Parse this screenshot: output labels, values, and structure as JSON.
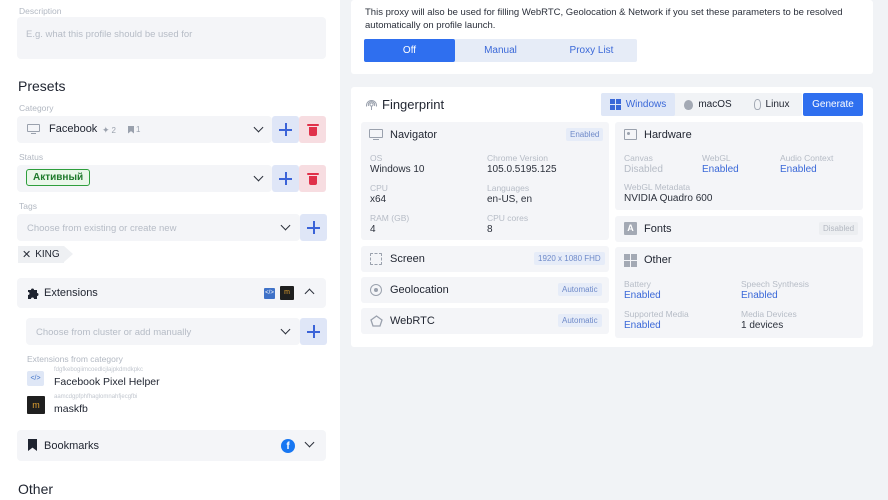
{
  "left": {
    "description": {
      "label": "Description",
      "placeholder": "E.g. what this profile should be used for"
    },
    "presets_title": "Presets",
    "category": {
      "label": "Category",
      "value": "Facebook",
      "pin_count": "2",
      "bookmark_count": "1"
    },
    "status": {
      "label": "Status",
      "value": "Активный",
      "color": "#2e9e3c"
    },
    "tags": {
      "label": "Tags",
      "placeholder": "Choose from existing or create new",
      "items": [
        "KING"
      ]
    },
    "extensions": {
      "title": "Extensions",
      "placeholder": "Choose from cluster or add manually",
      "from_category_label": "Extensions from category",
      "items": [
        {
          "id": "fdgfkebogiimcoedlcjlajpkdmdkpkc",
          "name": "Facebook Pixel Helper",
          "icon": "code-icon"
        },
        {
          "id": "aamcdgpfphfhaglomnahfjecgfbi",
          "name": "maskfb",
          "icon": "maskfb-icon"
        }
      ]
    },
    "bookmarks": {
      "title": "Bookmarks"
    },
    "other_title": "Other"
  },
  "proxy": {
    "note": "This proxy will also be used for filling WebRTC, Geolocation & Network if you set these parameters to be resolved automatically on profile launch.",
    "modes": [
      "Off",
      "Manual",
      "Proxy List"
    ],
    "active_mode": "Off"
  },
  "fingerprint": {
    "title": "Fingerprint",
    "os_tabs": [
      "Windows",
      "macOS",
      "Linux"
    ],
    "active_os": "Windows",
    "generate_label": "Generate",
    "navigator": {
      "title": "Navigator",
      "status": "Enabled",
      "fields": [
        {
          "key": "OS",
          "value": "Windows 10"
        },
        {
          "key": "Chrome Version",
          "value": "105.0.5195.125"
        },
        {
          "key": "CPU",
          "value": "x64"
        },
        {
          "key": "Languages",
          "value": "en-US, en"
        },
        {
          "key": "RAM (GB)",
          "value": "4"
        },
        {
          "key": "CPU cores",
          "value": "8"
        }
      ]
    },
    "screen": {
      "title": "Screen",
      "value": "1920 x 1080 FHD"
    },
    "geolocation": {
      "title": "Geolocation",
      "value": "Automatic"
    },
    "webrtc": {
      "title": "WebRTC",
      "value": "Automatic"
    },
    "hardware": {
      "title": "Hardware",
      "canvas": {
        "key": "Canvas",
        "value": "Disabled"
      },
      "webgl": {
        "key": "WebGL",
        "value": "Enabled"
      },
      "audio": {
        "key": "Audio Context",
        "value": "Enabled"
      },
      "webgl_meta": {
        "key": "WebGL Metadata",
        "value": "NVIDIA Quadro 600"
      }
    },
    "fonts": {
      "title": "Fonts",
      "status": "Disabled"
    },
    "other": {
      "title": "Other",
      "battery": {
        "key": "Battery",
        "value": "Enabled"
      },
      "speech": {
        "key": "Speech Synthesis",
        "value": "Enabled"
      },
      "media": {
        "key": "Supported Media",
        "value": "Enabled"
      },
      "devices": {
        "key": "Media Devices",
        "value": "1 devices"
      }
    }
  },
  "colors": {
    "accent": "#2f6fef",
    "danger": "#e0314a",
    "link": "#3a68d8"
  }
}
